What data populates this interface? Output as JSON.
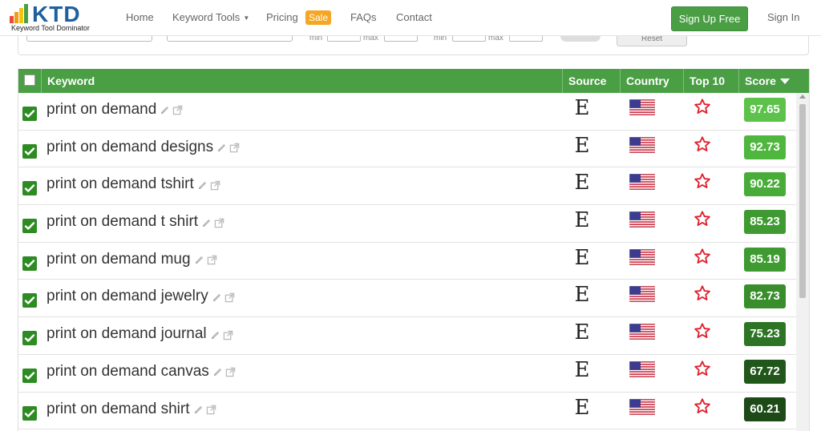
{
  "brand": {
    "name": "KTD",
    "tagline": "Keyword Tool Dominator",
    "colors": {
      "primary": "#4a9f45",
      "logo_blue": "#1f5fa0",
      "sale": "#f5a623"
    }
  },
  "nav": {
    "home": "Home",
    "keyword_tools": "Keyword Tools",
    "pricing": "Pricing",
    "sale_badge": "Sale",
    "faqs": "FAQs",
    "contact": "Contact",
    "signup": "Sign Up Free",
    "signin": "Sign In"
  },
  "filters": {
    "min_label": "min",
    "max_label": "max",
    "reset": "Reset"
  },
  "table": {
    "columns": {
      "keyword": "Keyword",
      "source": "Source",
      "country": "Country",
      "top10": "Top 10",
      "score": "Score"
    },
    "rows": [
      {
        "keyword": "print on demand",
        "source": "E",
        "country_icon": "us-flag-icon",
        "top10_icon": "star-outline-icon",
        "score": "97.65",
        "score_color": "#5cc24a",
        "checked": true
      },
      {
        "keyword": "print on demand designs",
        "source": "E",
        "country_icon": "us-flag-icon",
        "top10_icon": "star-outline-icon",
        "score": "92.73",
        "score_color": "#4fb63e",
        "checked": true
      },
      {
        "keyword": "print on demand tshirt",
        "source": "E",
        "country_icon": "us-flag-icon",
        "top10_icon": "star-outline-icon",
        "score": "90.22",
        "score_color": "#48ad38",
        "checked": true
      },
      {
        "keyword": "print on demand t shirt",
        "source": "E",
        "country_icon": "us-flag-icon",
        "top10_icon": "star-outline-icon",
        "score": "85.23",
        "score_color": "#3e9a31",
        "checked": true
      },
      {
        "keyword": "print on demand mug",
        "source": "E",
        "country_icon": "us-flag-icon",
        "top10_icon": "star-outline-icon",
        "score": "85.19",
        "score_color": "#3e9a31",
        "checked": true
      },
      {
        "keyword": "print on demand jewelry",
        "source": "E",
        "country_icon": "us-flag-icon",
        "top10_icon": "star-outline-icon",
        "score": "82.73",
        "score_color": "#378e2b",
        "checked": true
      },
      {
        "keyword": "print on demand journal",
        "source": "E",
        "country_icon": "us-flag-icon",
        "top10_icon": "star-outline-icon",
        "score": "75.23",
        "score_color": "#2d7524",
        "checked": true
      },
      {
        "keyword": "print on demand canvas",
        "source": "E",
        "country_icon": "us-flag-icon",
        "top10_icon": "star-outline-icon",
        "score": "67.72",
        "score_color": "#22571b",
        "checked": true
      },
      {
        "keyword": "print on demand shirt",
        "source": "E",
        "country_icon": "us-flag-icon",
        "top10_icon": "star-outline-icon",
        "score": "60.21",
        "score_color": "#1d4a17",
        "checked": true
      }
    ]
  }
}
